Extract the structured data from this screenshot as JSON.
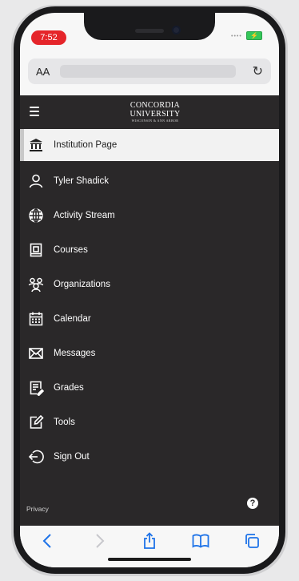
{
  "status_bar": {
    "time": "7:52"
  },
  "browser": {
    "text_size_label": "AA",
    "url": "",
    "reload_icon": "reload-icon"
  },
  "app": {
    "logo": {
      "line1": "CONCORDIA",
      "line2": "UNIVERSITY",
      "line3": "WISCONSIN & ANN ARBOR"
    },
    "menu": [
      {
        "label": "Institution Page",
        "icon": "institution-icon",
        "active": true
      },
      {
        "label": "Tyler Shadick",
        "icon": "user-icon"
      },
      {
        "label": "Activity Stream",
        "icon": "globe-icon"
      },
      {
        "label": "Courses",
        "icon": "courses-icon"
      },
      {
        "label": "Organizations",
        "icon": "organizations-icon"
      },
      {
        "label": "Calendar",
        "icon": "calendar-icon"
      },
      {
        "label": "Messages",
        "icon": "envelope-icon"
      },
      {
        "label": "Grades",
        "icon": "grades-icon"
      },
      {
        "label": "Tools",
        "icon": "tools-icon"
      },
      {
        "label": "Sign Out",
        "icon": "sign-out-icon"
      }
    ],
    "footer": {
      "privacy_label": "Privacy",
      "help_label": "?"
    }
  },
  "colors": {
    "app_background": "#2a2829",
    "active_item_background": "#f2f2f2",
    "ios_blue": "#1e73e8",
    "time_pill": "#e5252a"
  }
}
